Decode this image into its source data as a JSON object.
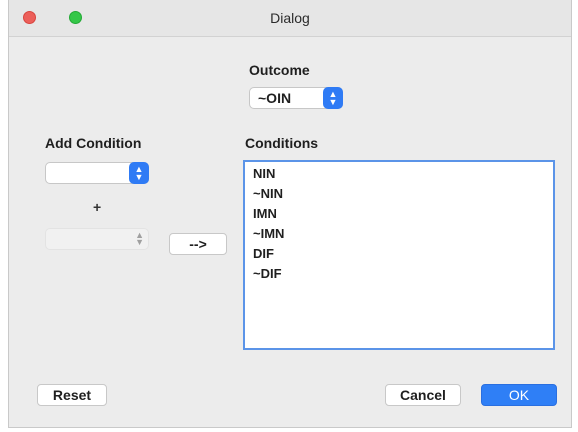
{
  "window": {
    "title": "Dialog"
  },
  "outcome": {
    "label": "Outcome",
    "selected": "~OIN"
  },
  "add_condition": {
    "label": "Add Condition",
    "selected": "",
    "plus": "+",
    "second_selected": ""
  },
  "move_button": {
    "label": "-->"
  },
  "conditions": {
    "label": "Conditions",
    "items": [
      "NIN",
      "~NIN",
      "IMN",
      "~IMN",
      "DIF",
      "~DIF"
    ]
  },
  "buttons": {
    "reset": "Reset",
    "cancel": "Cancel",
    "ok": "OK"
  },
  "colors": {
    "accent": "#2f7bf5",
    "list_border": "#5b94e8"
  }
}
